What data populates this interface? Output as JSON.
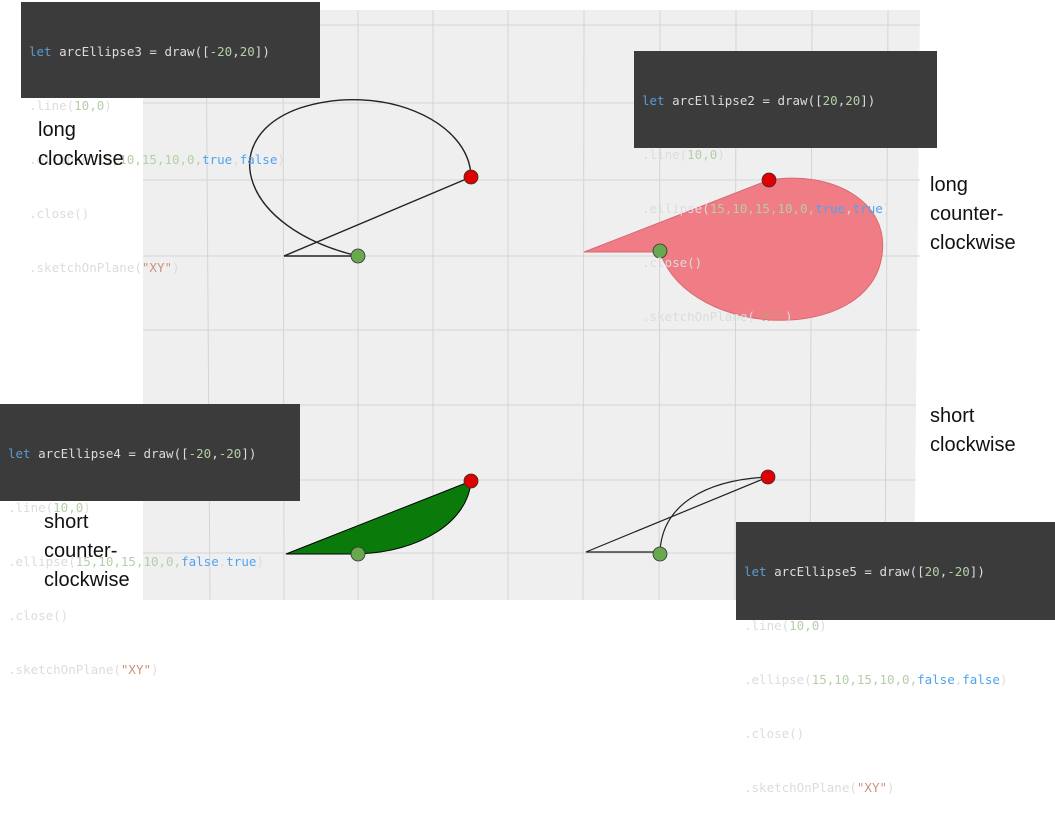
{
  "colors": {
    "viewport_bg": "#efefef",
    "grid_line": "#d4d4d4",
    "code_bg": "#3b3b3b",
    "keyword": "#5b9bd5",
    "number": "#b5cea8",
    "string": "#ce9178",
    "boolean": "#4fa3f0",
    "long_ccw_fill": "#f07c86",
    "short_ccw_fill": "#0a7a0a",
    "start_point": "#6aa84f",
    "end_point": "#e00000"
  },
  "code_blocks": {
    "arc3": {
      "line1": {
        "kw": "let",
        "name": " arcEllipse3 = draw([",
        "n1": "-20",
        "sep": ",",
        "n2": "20",
        "end": "])"
      },
      "line2": {
        "pre": ".line(",
        "args": "10,0",
        "post": ")"
      },
      "line3": {
        "pre": ".ellipse(",
        "nums": "15,10,15,10,0,",
        "b1": "true",
        "sep": ",",
        "b2": "false",
        "post": ")"
      },
      "line4": ".close()",
      "line5": {
        "pre": ".sketchOnPlane(",
        "str": "\"XY\"",
        "post": ")"
      }
    },
    "arc2": {
      "line1": {
        "kw": "let",
        "name": " arcEllipse2 = draw([",
        "n1": "20",
        "sep": ",",
        "n2": "20",
        "end": "])"
      },
      "line2": {
        "pre": ".line(",
        "args": "10,0",
        "post": ")"
      },
      "line3": {
        "pre": ".ellipse(",
        "nums": "15,10,15,10,0,",
        "b1": "true",
        "sep": ",",
        "b2": "true",
        "post": ")"
      },
      "line4": ".close()",
      "line5": {
        "pre": ".sketchOnPlane(",
        "str": "\"XY\"",
        "post": ")"
      }
    },
    "arc4": {
      "line1": {
        "kw": "let",
        "name": " arcEllipse4 = draw([",
        "n1": "-20",
        "sep": ",",
        "n2": "-20",
        "end": "])"
      },
      "line2": {
        "pre": ".line(",
        "args": "10,0",
        "post": ")"
      },
      "line3": {
        "pre": ".ellipse(",
        "nums": "15,10,15,10,0,",
        "b1": "false",
        "sep": ",",
        "b2": "true",
        "post": ")"
      },
      "line4": ".close()",
      "line5": {
        "pre": ".sketchOnPlane(",
        "str": "\"XY\"",
        "post": ")"
      }
    },
    "arc5": {
      "line1": {
        "kw": "let",
        "name": " arcEllipse5 = draw([",
        "n1": "20",
        "sep": ",",
        "n2": "-20",
        "end": "])"
      },
      "line2": {
        "pre": ".line(",
        "args": "10,0",
        "post": ")"
      },
      "line3": {
        "pre": ".ellipse(",
        "nums": "15,10,15,10,0,",
        "b1": "false",
        "sep": ",",
        "b2": "false",
        "post": ")"
      },
      "line4": ".close()",
      "line5": {
        "pre": ".sketchOnPlane(",
        "str": "\"XY\"",
        "post": ")"
      }
    }
  },
  "labels": {
    "long_cw": {
      "l1": "long",
      "l2": "clockwise"
    },
    "long_ccw": {
      "l1": "long",
      "l2": "counter-",
      "l3": "clockwise"
    },
    "short_cw": {
      "l1": "short",
      "l2": "clockwise"
    },
    "short_ccw": {
      "l1": "short",
      "l2": "counter-",
      "l3": "clockwise"
    }
  }
}
